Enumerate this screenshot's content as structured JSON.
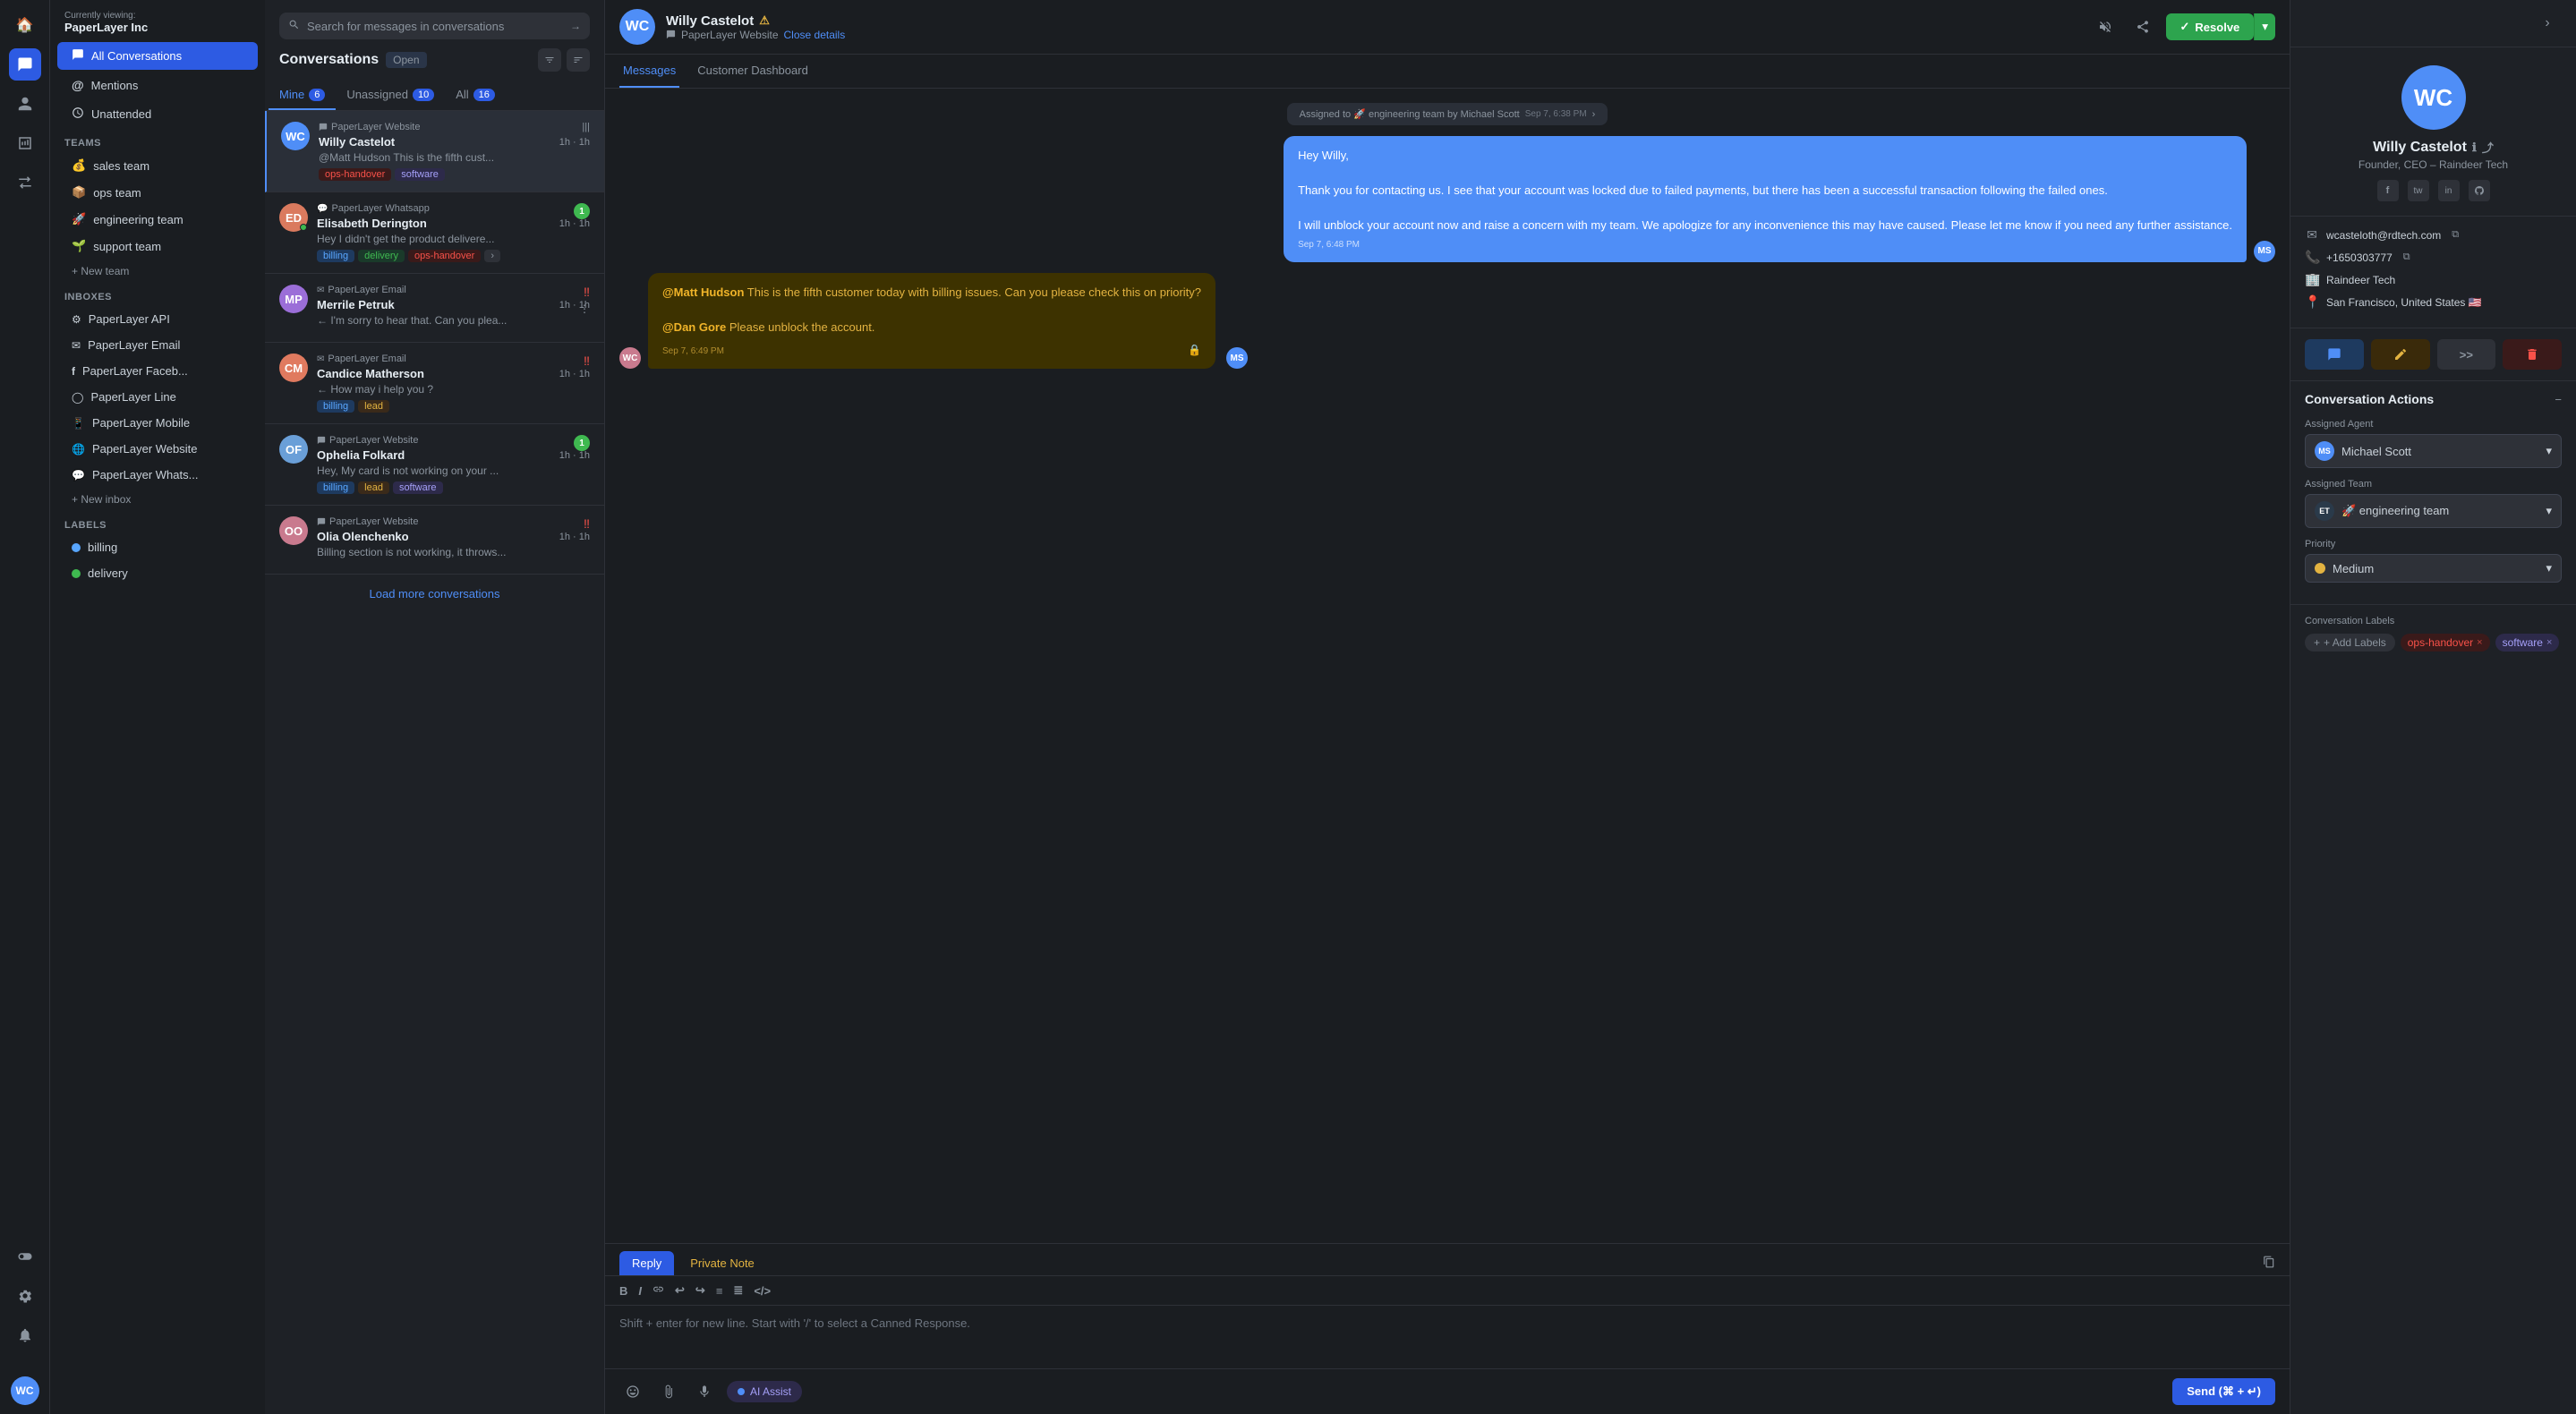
{
  "app": {
    "org": "PaperLayer Inc",
    "viewing_label": "Currently viewing:"
  },
  "left_sidebar": {
    "nav_items": [
      {
        "id": "conversations",
        "label": "All Conversations",
        "icon": "💬",
        "active": true
      },
      {
        "id": "mentions",
        "label": "Mentions",
        "icon": "@"
      },
      {
        "id": "unattended",
        "label": "Unattended",
        "icon": "⏰"
      }
    ],
    "teams_label": "Teams",
    "teams": [
      {
        "id": "sales",
        "label": "sales team",
        "emoji": "💰"
      },
      {
        "id": "ops",
        "label": "ops team",
        "emoji": "📦"
      },
      {
        "id": "engineering",
        "label": "engineering team",
        "emoji": "🚀"
      },
      {
        "id": "support",
        "label": "support team",
        "emoji": "🌱"
      }
    ],
    "new_team_label": "+ New team",
    "inboxes_label": "Inboxes",
    "inboxes": [
      {
        "id": "api",
        "label": "PaperLayer API",
        "icon": "⚙"
      },
      {
        "id": "email",
        "label": "PaperLayer Email",
        "icon": "✉"
      },
      {
        "id": "facebook",
        "label": "PaperLayer Faceb...",
        "icon": "f"
      },
      {
        "id": "line",
        "label": "PaperLayer Line",
        "icon": "◯"
      },
      {
        "id": "mobile",
        "label": "PaperLayer Mobile",
        "icon": "📱"
      },
      {
        "id": "website",
        "label": "PaperLayer Website",
        "icon": "🌐"
      },
      {
        "id": "whatsapp",
        "label": "PaperLayer Whats...",
        "icon": "💬"
      }
    ],
    "new_inbox_label": "+ New inbox",
    "labels_label": "Labels",
    "labels": [
      {
        "id": "billing",
        "label": "billing",
        "color": "#58a6ff"
      },
      {
        "id": "delivery",
        "label": "delivery",
        "color": "#3fb950"
      }
    ]
  },
  "icon_sidebar": {
    "icons": [
      {
        "id": "home",
        "symbol": "🏠",
        "active": false
      },
      {
        "id": "chat",
        "symbol": "💬",
        "active": true
      },
      {
        "id": "contacts",
        "symbol": "👤",
        "active": false
      },
      {
        "id": "reports",
        "symbol": "📊",
        "active": false
      },
      {
        "id": "campaigns",
        "symbol": "📣",
        "active": false
      },
      {
        "id": "integrations",
        "symbol": "🔌",
        "active": false
      },
      {
        "id": "settings",
        "symbol": "⚙",
        "active": false
      },
      {
        "id": "notifications",
        "symbol": "🔔",
        "active": false
      }
    ],
    "user_avatar": "WC"
  },
  "conv_list": {
    "title": "Conversations",
    "badge": "Open",
    "search_placeholder": "Search for messages in conversations",
    "tabs": [
      {
        "id": "mine",
        "label": "Mine",
        "count": "6"
      },
      {
        "id": "unassigned",
        "label": "Unassigned",
        "count": "10"
      },
      {
        "id": "all",
        "label": "All",
        "count": "16"
      }
    ],
    "active_tab": "mine",
    "conversations": [
      {
        "id": "c1",
        "source": "PaperLayer Website",
        "name": "Willy Castelot",
        "time": "1h · 1h",
        "preview": "@Matt Hudson This is the fifth cust...",
        "tags": [
          "ops-handover",
          "software"
        ],
        "avatar_initials": "WC",
        "avatar_color": "#4f8ef7",
        "active": true
      },
      {
        "id": "c2",
        "source": "PaperLayer Whatsapp",
        "name": "Elisabeth Derington",
        "time": "1h · 1h",
        "preview": "Hey I didn't get the product delivere...",
        "tags": [
          "billing",
          "delivery",
          "ops-handover",
          "+"
        ],
        "avatar_initials": "ED",
        "avatar_color": "#da7a5e",
        "unread": true,
        "unread_count": "1"
      },
      {
        "id": "c3",
        "source": "PaperLayer Email",
        "name": "Merrile Petruk",
        "time": "1h · 1h",
        "preview": "← I'm sorry to hear that. Can you plea...",
        "tags": [],
        "avatar_initials": "MP",
        "avatar_color": "#9b6ed8",
        "urgent": true
      },
      {
        "id": "c4",
        "source": "PaperLayer Email",
        "name": "Candice Matherson",
        "time": "1h · 1h",
        "preview": "← How may i help you ?",
        "tags": [
          "billing",
          "lead"
        ],
        "avatar_initials": "CM",
        "avatar_color": "#e07a5f",
        "urgent": true
      },
      {
        "id": "c5",
        "source": "PaperLayer Website",
        "name": "Ophelia Folkard",
        "time": "1h · 1h",
        "preview": "Hey, My card is not working on your ...",
        "tags": [
          "billing",
          "lead",
          "software"
        ],
        "avatar_initials": "OF",
        "avatar_color": "#6a9fd8",
        "unread_count": "1"
      },
      {
        "id": "c6",
        "source": "PaperLayer Website",
        "name": "Olia Olenchenko",
        "time": "1h · 1h",
        "preview": "Billing section is not working, it throws...",
        "tags": [],
        "avatar_initials": "OO",
        "avatar_color": "#c97a8e",
        "urgent_dbl": true
      }
    ],
    "load_more_label": "Load more conversations"
  },
  "chat": {
    "contact_name": "Willy Castelot",
    "contact_source": "PaperLayer Website",
    "close_details_label": "Close details",
    "tabs": [
      {
        "id": "messages",
        "label": "Messages",
        "active": true
      },
      {
        "id": "dashboard",
        "label": "Customer Dashboard"
      }
    ],
    "messages": [
      {
        "id": "m0",
        "type": "system",
        "text": "Assigned to 🚀 engineering team by Michael Scott",
        "time": "Sep 7, 6:38 PM"
      },
      {
        "id": "m1",
        "type": "outgoing",
        "text": "Hey Willy,\n\nThank you for contacting us. I see that your account was locked due to failed payments, but there has been a successful transaction following the failed ones.\n\nI will unblock your account now and raise a concern with my team. We apologize for any inconvenience this may have caused. Please let me know if you need any further assistance.",
        "time": "Sep 7, 6:48 PM",
        "sender_initials": "MS"
      },
      {
        "id": "m2",
        "type": "internal",
        "content": "@Matt Hudson This is the fifth customer today with billing issues. Can you please check this on priority?\n\n@Dan Gore Please unblock the account.",
        "time": "Sep 7, 6:49 PM",
        "sender_initials": "WC",
        "has_lock": true
      }
    ],
    "reply_tab": "Reply",
    "private_note_tab": "Private Note",
    "toolbar_buttons": [
      "B",
      "I",
      "🔗",
      "↩",
      "↪",
      "≡",
      "≣",
      "</>"
    ],
    "reply_placeholder": "Shift + enter for new line. Start with '/' to select a Canned Response.",
    "send_label": "Send (⌘ + ↵)"
  },
  "right_panel": {
    "contact": {
      "name": "Willy Castelot",
      "role": "Founder, CEO – Raindeer Tech",
      "avatar_initials": "WC",
      "avatar_color": "#4f8ef7",
      "socials": [
        "f",
        "tw",
        "in",
        "gh"
      ],
      "email": "wcasteloth@rdtech.com",
      "phone": "+1650303777",
      "company": "Raindeer Tech",
      "location": "San Francisco, United States 🇺🇸"
    },
    "action_buttons": [
      {
        "id": "new-conv",
        "icon": "💬",
        "style": "blue"
      },
      {
        "id": "edit",
        "icon": "✏",
        "style": "orange"
      },
      {
        "id": "forward",
        "icon": ">>",
        "style": "gray"
      },
      {
        "id": "delete",
        "icon": "🗑",
        "style": "red"
      }
    ],
    "conv_actions_title": "Conversation Actions",
    "assigned_agent_label": "Assigned Agent",
    "assigned_agent": "Michael Scott",
    "assigned_team_label": "Assigned Team",
    "assigned_team": "🚀 engineering team",
    "assigned_team_initials": "ET",
    "priority_label": "Priority",
    "priority": "Medium",
    "conv_labels_title": "Conversation Labels",
    "add_labels_label": "+ Add Labels",
    "labels": [
      {
        "id": "ops-handover",
        "text": "ops-handover",
        "style": "ops"
      },
      {
        "id": "software",
        "text": "software",
        "style": "software"
      }
    ]
  }
}
